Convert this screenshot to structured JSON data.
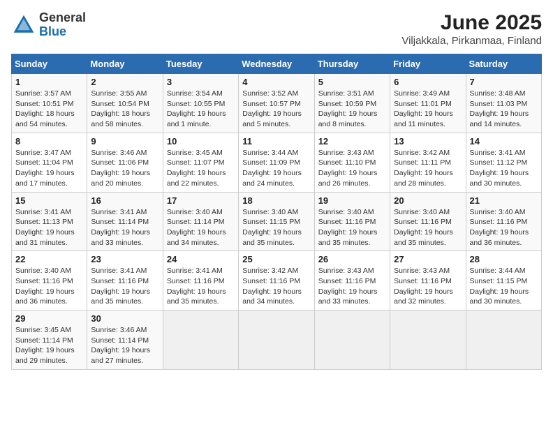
{
  "header": {
    "logo_general": "General",
    "logo_blue": "Blue",
    "title": "June 2025",
    "subtitle": "Viljakkala, Pirkanmaa, Finland"
  },
  "weekdays": [
    "Sunday",
    "Monday",
    "Tuesday",
    "Wednesday",
    "Thursday",
    "Friday",
    "Saturday"
  ],
  "weeks": [
    [
      {
        "day": "1",
        "info": "Sunrise: 3:57 AM\nSunset: 10:51 PM\nDaylight: 18 hours\nand 54 minutes."
      },
      {
        "day": "2",
        "info": "Sunrise: 3:55 AM\nSunset: 10:54 PM\nDaylight: 18 hours\nand 58 minutes."
      },
      {
        "day": "3",
        "info": "Sunrise: 3:54 AM\nSunset: 10:55 PM\nDaylight: 19 hours\nand 1 minute."
      },
      {
        "day": "4",
        "info": "Sunrise: 3:52 AM\nSunset: 10:57 PM\nDaylight: 19 hours\nand 5 minutes."
      },
      {
        "day": "5",
        "info": "Sunrise: 3:51 AM\nSunset: 10:59 PM\nDaylight: 19 hours\nand 8 minutes."
      },
      {
        "day": "6",
        "info": "Sunrise: 3:49 AM\nSunset: 11:01 PM\nDaylight: 19 hours\nand 11 minutes."
      },
      {
        "day": "7",
        "info": "Sunrise: 3:48 AM\nSunset: 11:03 PM\nDaylight: 19 hours\nand 14 minutes."
      }
    ],
    [
      {
        "day": "8",
        "info": "Sunrise: 3:47 AM\nSunset: 11:04 PM\nDaylight: 19 hours\nand 17 minutes."
      },
      {
        "day": "9",
        "info": "Sunrise: 3:46 AM\nSunset: 11:06 PM\nDaylight: 19 hours\nand 20 minutes."
      },
      {
        "day": "10",
        "info": "Sunrise: 3:45 AM\nSunset: 11:07 PM\nDaylight: 19 hours\nand 22 minutes."
      },
      {
        "day": "11",
        "info": "Sunrise: 3:44 AM\nSunset: 11:09 PM\nDaylight: 19 hours\nand 24 minutes."
      },
      {
        "day": "12",
        "info": "Sunrise: 3:43 AM\nSunset: 11:10 PM\nDaylight: 19 hours\nand 26 minutes."
      },
      {
        "day": "13",
        "info": "Sunrise: 3:42 AM\nSunset: 11:11 PM\nDaylight: 19 hours\nand 28 minutes."
      },
      {
        "day": "14",
        "info": "Sunrise: 3:41 AM\nSunset: 11:12 PM\nDaylight: 19 hours\nand 30 minutes."
      }
    ],
    [
      {
        "day": "15",
        "info": "Sunrise: 3:41 AM\nSunset: 11:13 PM\nDaylight: 19 hours\nand 31 minutes."
      },
      {
        "day": "16",
        "info": "Sunrise: 3:41 AM\nSunset: 11:14 PM\nDaylight: 19 hours\nand 33 minutes."
      },
      {
        "day": "17",
        "info": "Sunrise: 3:40 AM\nSunset: 11:14 PM\nDaylight: 19 hours\nand 34 minutes."
      },
      {
        "day": "18",
        "info": "Sunrise: 3:40 AM\nSunset: 11:15 PM\nDaylight: 19 hours\nand 35 minutes."
      },
      {
        "day": "19",
        "info": "Sunrise: 3:40 AM\nSunset: 11:16 PM\nDaylight: 19 hours\nand 35 minutes."
      },
      {
        "day": "20",
        "info": "Sunrise: 3:40 AM\nSunset: 11:16 PM\nDaylight: 19 hours\nand 35 minutes."
      },
      {
        "day": "21",
        "info": "Sunrise: 3:40 AM\nSunset: 11:16 PM\nDaylight: 19 hours\nand 36 minutes."
      }
    ],
    [
      {
        "day": "22",
        "info": "Sunrise: 3:40 AM\nSunset: 11:16 PM\nDaylight: 19 hours\nand 36 minutes."
      },
      {
        "day": "23",
        "info": "Sunrise: 3:41 AM\nSunset: 11:16 PM\nDaylight: 19 hours\nand 35 minutes."
      },
      {
        "day": "24",
        "info": "Sunrise: 3:41 AM\nSunset: 11:16 PM\nDaylight: 19 hours\nand 35 minutes."
      },
      {
        "day": "25",
        "info": "Sunrise: 3:42 AM\nSunset: 11:16 PM\nDaylight: 19 hours\nand 34 minutes."
      },
      {
        "day": "26",
        "info": "Sunrise: 3:43 AM\nSunset: 11:16 PM\nDaylight: 19 hours\nand 33 minutes."
      },
      {
        "day": "27",
        "info": "Sunrise: 3:43 AM\nSunset: 11:16 PM\nDaylight: 19 hours\nand 32 minutes."
      },
      {
        "day": "28",
        "info": "Sunrise: 3:44 AM\nSunset: 11:15 PM\nDaylight: 19 hours\nand 30 minutes."
      }
    ],
    [
      {
        "day": "29",
        "info": "Sunrise: 3:45 AM\nSunset: 11:14 PM\nDaylight: 19 hours\nand 29 minutes."
      },
      {
        "day": "30",
        "info": "Sunrise: 3:46 AM\nSunset: 11:14 PM\nDaylight: 19 hours\nand 27 minutes."
      },
      {
        "day": "",
        "info": ""
      },
      {
        "day": "",
        "info": ""
      },
      {
        "day": "",
        "info": ""
      },
      {
        "day": "",
        "info": ""
      },
      {
        "day": "",
        "info": ""
      }
    ]
  ]
}
